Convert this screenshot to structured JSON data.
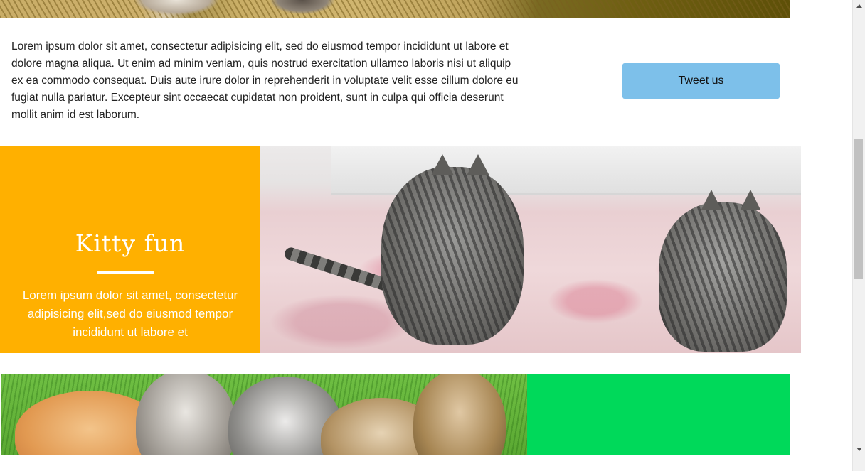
{
  "intro": {
    "body": "Lorem ipsum dolor sit amet, consectetur adipisicing elit, sed do eiusmod tempor incididunt ut labore et dolore magna aliqua. Ut enim ad minim veniam, quis nostrud exercitation ullamco laboris nisi ut aliquip ex ea commodo consequat. Duis aute irure dolor in reprehenderit in voluptate velit esse cillum dolore eu fugiat nulla pariatur. Excepteur sint occaecat cupidatat non proident, sunt in culpa qui officia deserunt mollit anim id est laborum.",
    "tweet_button": "Tweet us"
  },
  "feature": {
    "title": "Kitty fun",
    "text": "Lorem ipsum dolor sit amet, consectetur adipisicing elit,sed do eiusmod tempor incididunt ut labore et"
  },
  "colors": {
    "feature_bg": "#ffb000",
    "tweet_button_bg": "#7dc0ea",
    "green_panel_bg": "#00d95a"
  },
  "images": {
    "hero": "kitten-on-sweater-photo",
    "feature": "two-kittens-playing-on-bed-photo",
    "bottom": "kittens-on-grass-photo"
  }
}
